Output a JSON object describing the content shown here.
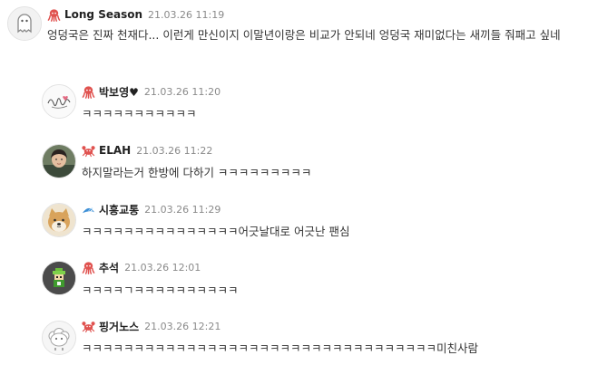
{
  "comments": [
    {
      "nickname": "Long Season",
      "time": "21.03.26 11:19",
      "text": "엉덩국은 진짜 천재다... 이런게 만신이지 이말년이랑은 비교가 안되네 엉덩국 재미없다는 새끼들 줘패고 싶네",
      "badge_icon": "octopus-icon",
      "badge_color": "#e0524f",
      "avatar": "ghost-avatar"
    },
    {
      "nickname": "박보영♥",
      "time": "21.03.26 11:20",
      "text": "ㅋㅋㅋㅋㅋㅋㅋㅋㅋㅋㅋ",
      "badge_icon": "octopus-icon",
      "badge_color": "#e0524f",
      "avatar": "signature-avatar"
    },
    {
      "nickname": "ELAH",
      "time": "21.03.26 11:22",
      "text": "하지말라는거 한방에 다하기 ㅋㅋㅋㅋㅋㅋㅋㅋㅋ",
      "badge_icon": "crab-icon",
      "badge_color": "#e0524f",
      "avatar": "person-photo-avatar"
    },
    {
      "nickname": "시흥교통",
      "time": "21.03.26 11:29",
      "text": "ㅋㅋㅋㅋㅋㅋㅋㅋㅋㅋㅋㅋㅋㅋㅋ어긋날대로 어긋난 팬심",
      "badge_icon": "fish-icon",
      "badge_color": "#3d8fd6",
      "avatar": "shiba-dog-avatar"
    },
    {
      "nickname": "추석",
      "time": "21.03.26 12:01",
      "text": "ㅋㅋㅋㅋㄱㅋㅋㅋㅋㅋㅋㅋㅋㅋㅋ",
      "badge_icon": "octopus-icon",
      "badge_color": "#e0524f",
      "avatar": "pixel-character-avatar"
    },
    {
      "nickname": "핑거노스",
      "time": "21.03.26 12:21",
      "text": "ㅋㅋㅋㅋㅋㅋㅋㅋㅋㅋㅋㅋㅋㅋㅋㅋㅋㅋㅋㅋㅋㅋㅋㅋㅋㅋㅋㅋㅋㅋㅋㅋㅋㅋ미친사람",
      "badge_icon": "crab-icon",
      "badge_color": "#e0524f",
      "avatar": "sheep-avatar"
    }
  ]
}
